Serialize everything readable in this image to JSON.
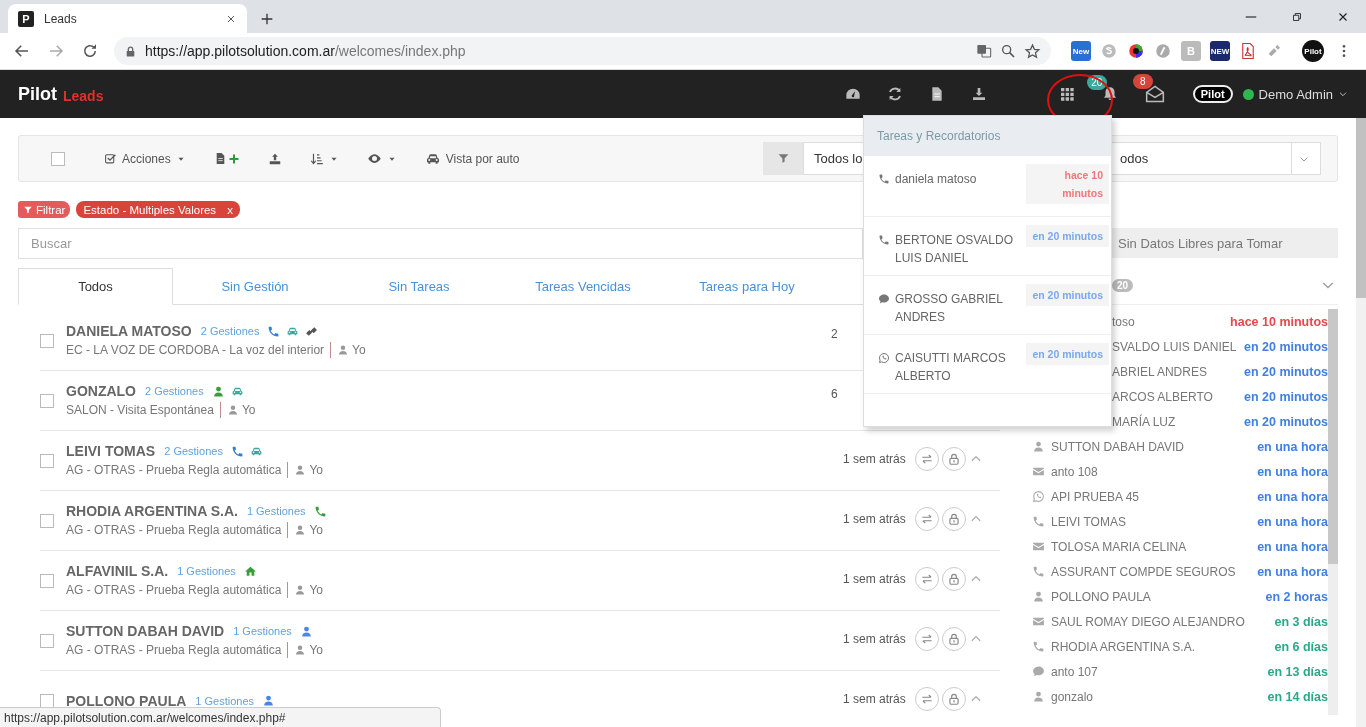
{
  "browser": {
    "tab_title": "Leads",
    "tab_favicon": "P",
    "url_host": "https://app.pilotsolution.com.ar",
    "url_path": "/welcomes/index.php",
    "extensions": [
      {
        "kind": "news",
        "label": "New"
      },
      {
        "kind": "skype"
      },
      {
        "kind": "color-wheel"
      },
      {
        "kind": "coin"
      },
      {
        "kind": "letter",
        "label": "B"
      },
      {
        "kind": "news-dark",
        "label": "NEW"
      },
      {
        "kind": "pdf"
      },
      {
        "kind": "tool"
      }
    ],
    "profile": "Pilot"
  },
  "app": {
    "brand": "Pilot",
    "module": "Leads",
    "notifications": "20",
    "messages": "8",
    "logo": "Pilot",
    "user": "Demo Admin",
    "online": true,
    "highlight_circle": true
  },
  "toolbar": {
    "select_all_checked": false,
    "actions_label": "Acciones",
    "car_view_label": "Vista por auto",
    "filter_select_1": "Todos lo",
    "filter_select_2": "odos"
  },
  "filters": {
    "filter_button": "Filtrar",
    "chips": [
      {
        "label": "Estado - Multiples Valores",
        "remove": "x"
      }
    ]
  },
  "search": {
    "placeholder": "Buscar"
  },
  "tabs": [
    {
      "label": "Todos",
      "selected": true
    },
    {
      "label": "Sin Gestión",
      "selected": false
    },
    {
      "label": "Sin Tareas",
      "selected": false
    },
    {
      "label": "Tareas Vencidas",
      "selected": false
    },
    {
      "label": "Tareas para Hoy",
      "selected": false
    }
  ],
  "leads": [
    {
      "checked": false,
      "name": "DANIELA MATOSO",
      "count": "2 Gestiones",
      "icons": [
        {
          "kind": "phone",
          "color": "#2f7fd6"
        },
        {
          "kind": "car",
          "color": "#3aa89a"
        },
        {
          "kind": "link",
          "color": "#555555"
        }
      ],
      "source": "EC - LA VOZ DE CORDOBA - La voz del interior",
      "owner": "Yo",
      "time": "2",
      "actions": false
    },
    {
      "checked": false,
      "name": "GONZALO",
      "count": "2 Gestiones",
      "icons": [
        {
          "kind": "user",
          "color": "#3a9d3a"
        },
        {
          "kind": "car",
          "color": "#3aa89a"
        }
      ],
      "source": "SALON - Visita Espontánea",
      "owner": "Yo",
      "time": "6",
      "actions": false
    },
    {
      "checked": false,
      "name": "LEIVI TOMAS",
      "count": "2 Gestiones",
      "icons": [
        {
          "kind": "phone",
          "color": "#2f7fd6"
        },
        {
          "kind": "car",
          "color": "#3aa89a"
        }
      ],
      "source": "AG - OTRAS - Prueba Regla automática",
      "owner": "Yo",
      "time": "1 sem atrás",
      "actions": true
    },
    {
      "checked": false,
      "name": "RHODIA ARGENTINA S.A.",
      "count": "1 Gestiones",
      "icons": [
        {
          "kind": "phone",
          "color": "#3a9d3a"
        }
      ],
      "source": "AG - OTRAS - Prueba Regla automática",
      "owner": "Yo",
      "time": "1 sem atrás",
      "actions": true
    },
    {
      "checked": false,
      "name": "ALFAVINIL S.A.",
      "count": "1 Gestiones",
      "icons": [
        {
          "kind": "home",
          "color": "#3a9d3a"
        }
      ],
      "source": "AG - OTRAS - Prueba Regla automática",
      "owner": "Yo",
      "time": "1 sem atrás",
      "actions": true
    },
    {
      "checked": false,
      "name": "SUTTON DABAH DAVID",
      "count": "1 Gestiones",
      "icons": [
        {
          "kind": "user",
          "color": "#4a86e8"
        }
      ],
      "source": "AG - OTRAS - Prueba Regla automática",
      "owner": "Yo",
      "time": "1 sem atrás",
      "actions": true
    },
    {
      "checked": false,
      "name": "POLLONO PAULA",
      "count": "1 Gestiones",
      "icons": [
        {
          "kind": "user",
          "color": "#4a86e8"
        }
      ],
      "time": "1 sem atrás",
      "actions": true
    }
  ],
  "side_panel": {
    "free_data": "Sin Datos Libres para Tomar",
    "count": "20",
    "tasks": [
      {
        "kind": "partial",
        "name": "toso",
        "time": "hace 10 minutos",
        "color": "#e8474b"
      },
      {
        "kind": "partial",
        "name": "SVALDO LUIS DANIEL",
        "time": "en 20 minutos",
        "color": "#3f7fe6"
      },
      {
        "kind": "partial",
        "name": "ABRIEL ANDRES",
        "time": "en 20 minutos",
        "color": "#3f7fe6"
      },
      {
        "kind": "partial",
        "name": "ARCOS ALBERTO",
        "time": "en 20 minutos",
        "color": "#3f7fe6"
      },
      {
        "kind": "partial",
        "name": "MARÍA LUZ",
        "time": "en 20 minutos",
        "color": "#3f7fe6"
      },
      {
        "kind": "user",
        "name": "SUTTON DABAH DAVID",
        "time": "en una hora",
        "color": "#3f7fe6"
      },
      {
        "kind": "envelope",
        "name": "anto 108",
        "time": "en una hora",
        "color": "#3f7fe6"
      },
      {
        "kind": "whatsapp",
        "name": "API PRUEBA 45",
        "time": "en una hora",
        "color": "#3f7fe6"
      },
      {
        "kind": "phone",
        "name": "LEIVI TOMAS",
        "time": "en una hora",
        "color": "#3f7fe6"
      },
      {
        "kind": "envelope",
        "name": "TOLOSA MARIA CELINA",
        "time": "en una hora",
        "color": "#3f7fe6"
      },
      {
        "kind": "phone",
        "name": "ASSURANT COMPDE SEGUROS",
        "time": "en una hora",
        "color": "#3f7fe6"
      },
      {
        "kind": "user",
        "name": "POLLONO PAULA",
        "time": "en 2 horas",
        "color": "#3f7fe6"
      },
      {
        "kind": "envelope",
        "name": "SAUL ROMAY DIEGO ALEJANDRO",
        "time": "en 3 días",
        "color": "#2aa88a"
      },
      {
        "kind": "phone",
        "name": "RHODIA ARGENTINA S.A.",
        "time": "en 6 días",
        "color": "#2aa88a"
      },
      {
        "kind": "comment",
        "name": "anto 107",
        "time": "en 13 días",
        "color": "#2aa88a"
      },
      {
        "kind": "user",
        "name": "gonzalo",
        "time": "en 14 días",
        "color": "#2aa88a"
      }
    ]
  },
  "notifications_dropdown": {
    "title": "Tareas y Recordatorios",
    "items": [
      {
        "kind": "phone",
        "name": "daniela matoso",
        "time": "hace 10 minutos",
        "color": "#f0777a"
      },
      {
        "kind": "phone",
        "name": "BERTONE OSVALDO LUIS DANIEL",
        "time": "en 20 minutos",
        "color": "#7aa7f0"
      },
      {
        "kind": "comment",
        "name": "GROSSO GABRIEL ANDRES",
        "time": "en 20 minutos",
        "color": "#7aa7f0"
      },
      {
        "kind": "whatsapp",
        "name": "CAISUTTI MARCOS ALBERTO",
        "time": "en 20 minutos",
        "color": "#7aa7f0"
      }
    ]
  },
  "status_bar": {
    "url": "https://app.pilotsolution.com.ar/welcomes/index.php#"
  }
}
